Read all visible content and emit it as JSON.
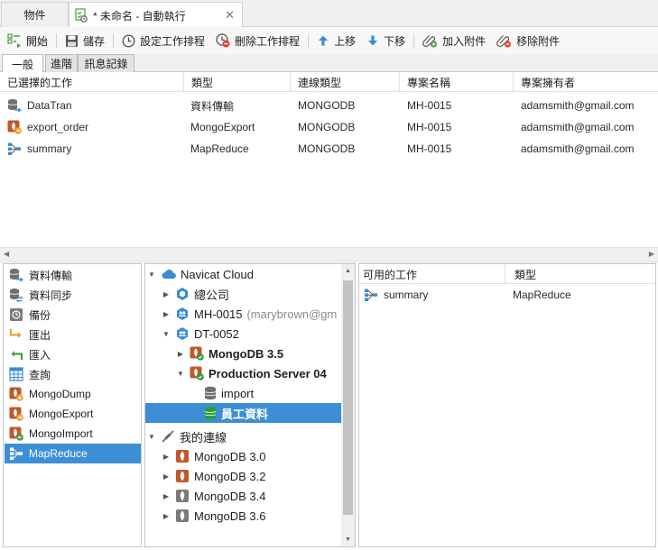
{
  "doc_tabs": {
    "objects_label": "物件",
    "active_label": "* 未命名 - 自動執行",
    "close_symbol": "✕"
  },
  "toolbar": {
    "start": "開始",
    "save": "儲存",
    "set_schedule": "設定工作排程",
    "delete_schedule": "刪除工作排程",
    "move_up": "上移",
    "move_down": "下移",
    "add_attachment": "加入附件",
    "remove_attachment": "移除附件"
  },
  "sub_tabs": [
    "一般",
    "進階",
    "訊息記錄"
  ],
  "selected_jobs": {
    "columns": [
      "已選擇的工作",
      "類型",
      "連線類型",
      "專案名稱",
      "專案擁有者"
    ],
    "rows": [
      {
        "name": "DataTran",
        "type": "資料傳輸",
        "conn": "MONGODB",
        "project": "MH-0015",
        "owner": "adamsmith@gmail.com",
        "icon": "data-transfer-icon"
      },
      {
        "name": "export_order",
        "type": "MongoExport",
        "conn": "MONGODB",
        "project": "MH-0015",
        "owner": "adamsmith@gmail.com",
        "icon": "mongo-export-icon"
      },
      {
        "name": "summary",
        "type": "MapReduce",
        "conn": "MONGODB",
        "project": "MH-0015",
        "owner": "adamsmith@gmail.com",
        "icon": "mapreduce-icon"
      }
    ]
  },
  "job_types": [
    {
      "label": "資料傳輸",
      "icon": "data-transfer-icon"
    },
    {
      "label": "資料同步",
      "icon": "data-sync-icon"
    },
    {
      "label": "備份",
      "icon": "backup-icon"
    },
    {
      "label": "匯出",
      "icon": "export-icon"
    },
    {
      "label": "匯入",
      "icon": "import-icon"
    },
    {
      "label": "查詢",
      "icon": "query-icon"
    },
    {
      "label": "MongoDump",
      "icon": "mongo-dump-icon"
    },
    {
      "label": "MongoExport",
      "icon": "mongo-export-icon"
    },
    {
      "label": "MongoImport",
      "icon": "mongo-import-icon"
    },
    {
      "label": "MapReduce",
      "icon": "mapreduce-icon",
      "selected": true
    }
  ],
  "tree": {
    "cloud_root": "Navicat Cloud",
    "company": "總公司",
    "mh_project": "MH-0015",
    "mh_owner": "(marybrown@gm",
    "dt_project": "DT-0052",
    "mongo35": "MongoDB 3.5",
    "production": "Production Server 04",
    "import_db": "import",
    "staff_db": "員工資料",
    "my_connections": "我的連線",
    "conn30": "MongoDB 3.0",
    "conn32": "MongoDB 3.2",
    "conn34": "MongoDB 3.4",
    "conn36": "MongoDB 3.6"
  },
  "available_jobs": {
    "columns": [
      "可用的工作",
      "類型"
    ],
    "rows": [
      {
        "name": "summary",
        "type": "MapReduce",
        "icon": "mapreduce-icon"
      }
    ]
  },
  "colors": {
    "selection": "#3c8fd5",
    "mongo_leaf": "#c0572a",
    "db_green": "#2e9d3c",
    "cloud_blue": "#3b8ad6"
  }
}
